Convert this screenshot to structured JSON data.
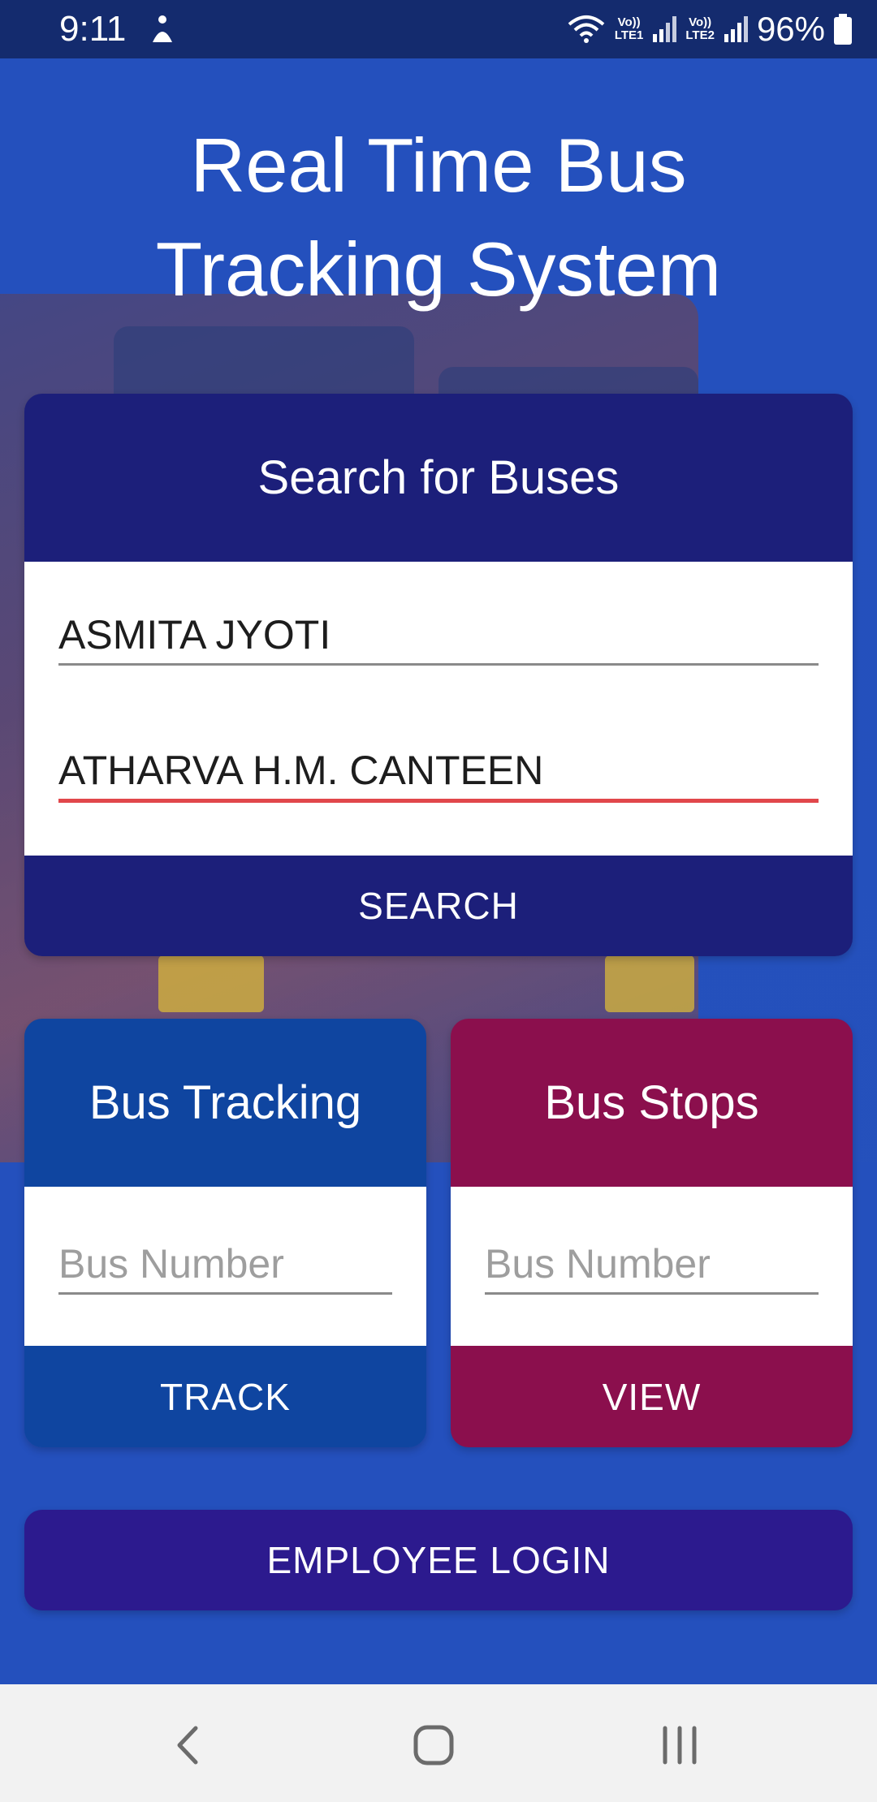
{
  "status_bar": {
    "time": "9:11",
    "battery": "96%",
    "sim1": "LTE1",
    "sim2": "LTE2",
    "volte": "Vo))"
  },
  "app": {
    "title": "Real Time Bus\nTracking System"
  },
  "search_card": {
    "header": "Search for Buses",
    "from_value": "ASMITA JYOTI",
    "to_value": "ATHARVA H.M. CANTEEN",
    "button": "SEARCH"
  },
  "tracking_card": {
    "header": "Bus Tracking",
    "placeholder": "Bus Number",
    "button": "TRACK"
  },
  "stops_card": {
    "header": "Bus Stops",
    "placeholder": "Bus Number",
    "button": "VIEW"
  },
  "employee_login": {
    "button": "EMPLOYEE LOGIN"
  },
  "colors": {
    "background": "#2450bd",
    "search_header": "#1c1f7a",
    "tracking": "#0f45a0",
    "stops": "#8b0f4d",
    "login": "#2c1a8e",
    "active_underline": "#e1474b"
  },
  "nav_bar": {
    "icons": [
      "back-icon",
      "home-icon",
      "recents-icon"
    ]
  }
}
